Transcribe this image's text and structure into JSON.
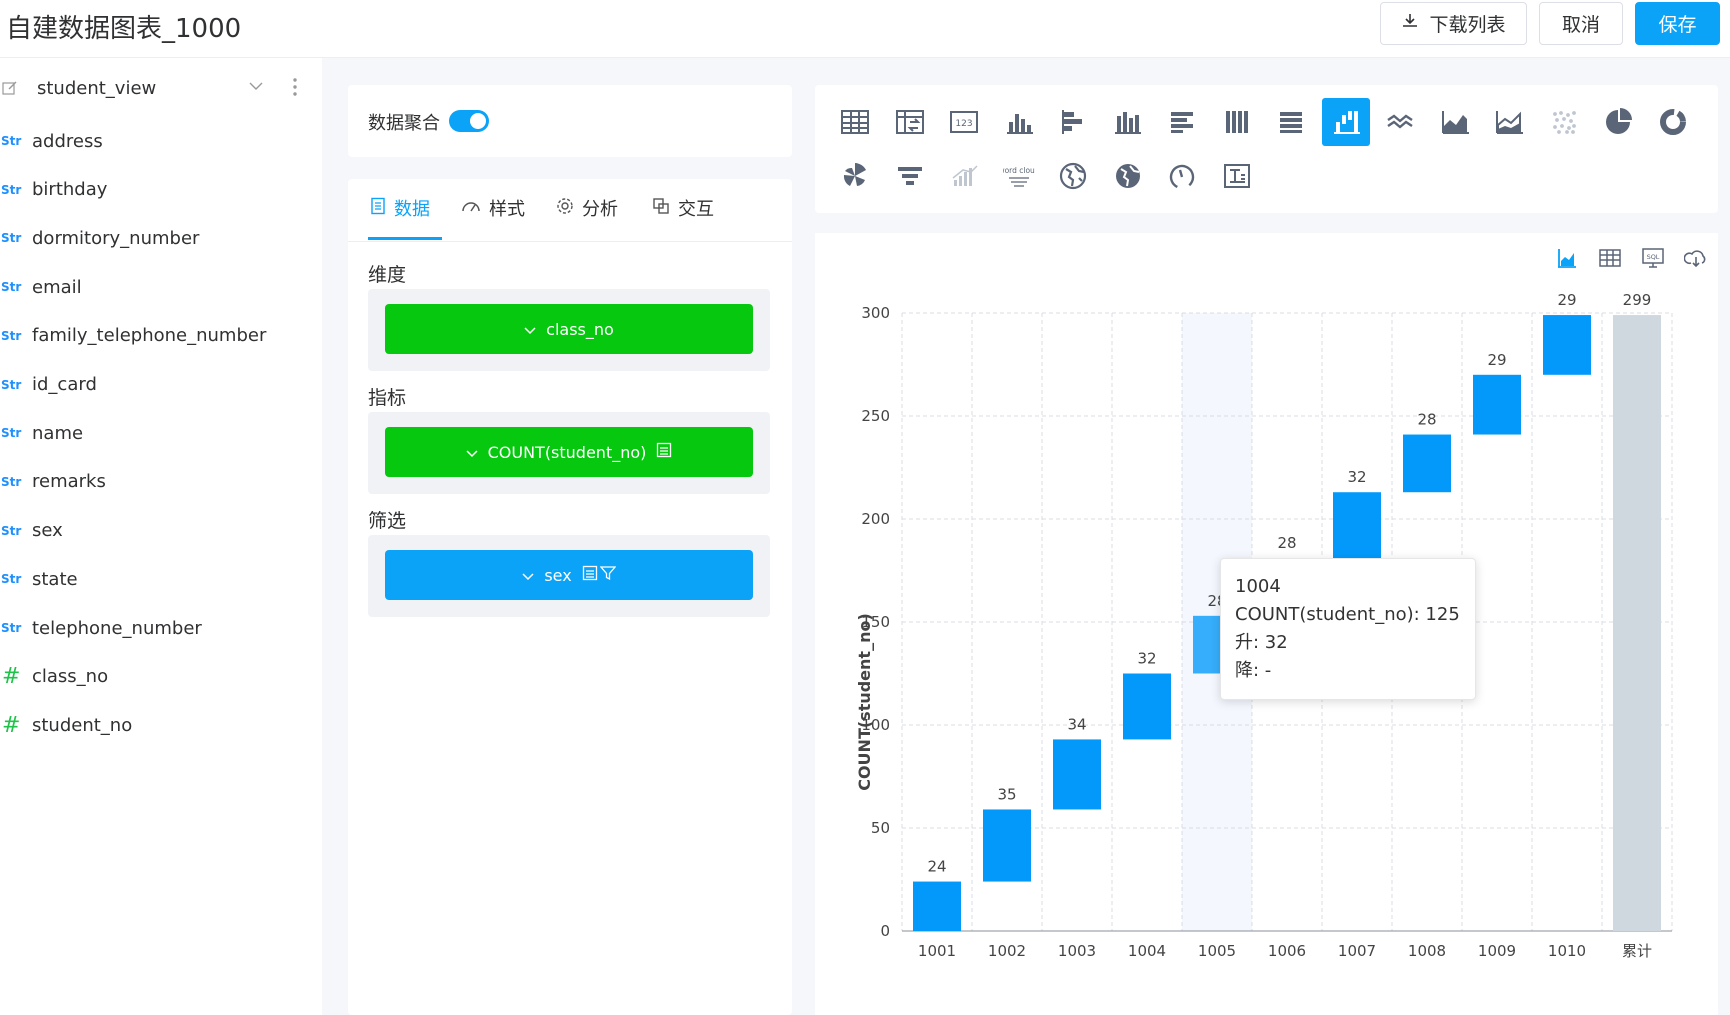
{
  "header": {
    "title": "自建数据图表_1000",
    "download_label": "下载列表",
    "cancel_label": "取消",
    "save_label": "保存"
  },
  "sidebar": {
    "view_name": "student_view",
    "fields": [
      {
        "type": "Str",
        "name": "address"
      },
      {
        "type": "Str",
        "name": "birthday"
      },
      {
        "type": "Str",
        "name": "dormitory_number"
      },
      {
        "type": "Str",
        "name": "email"
      },
      {
        "type": "Str",
        "name": "family_telephone_number"
      },
      {
        "type": "Str",
        "name": "id_card"
      },
      {
        "type": "Str",
        "name": "name"
      },
      {
        "type": "Str",
        "name": "remarks"
      },
      {
        "type": "Str",
        "name": "sex"
      },
      {
        "type": "Str",
        "name": "state"
      },
      {
        "type": "Str",
        "name": "telephone_number"
      },
      {
        "type": "#",
        "name": "class_no"
      },
      {
        "type": "#",
        "name": "student_no"
      }
    ]
  },
  "config": {
    "aggregate_label": "数据聚合",
    "aggregate_on": true,
    "tabs": [
      {
        "label": "数据",
        "icon": "data-icon",
        "active": true
      },
      {
        "label": "样式",
        "icon": "style-icon",
        "active": false
      },
      {
        "label": "分析",
        "icon": "analysis-icon",
        "active": false
      },
      {
        "label": "交互",
        "icon": "interaction-icon",
        "active": false
      }
    ],
    "dimension_label": "维度",
    "dimension_value": "class_no",
    "metric_label": "指标",
    "metric_value": "COUNT(student_no)",
    "filter_label": "筛选",
    "filter_value": "sex"
  },
  "chart_types": {
    "selected": "waterfall",
    "icons": [
      "table-icon",
      "pivot-table-icon",
      "number-card-icon",
      "bar-chart-icon",
      "horizontal-bar-icon",
      "grouped-column-icon",
      "stacked-horizontal-bar-icon",
      "percent-column-icon",
      "percent-horizontal-bar-icon",
      "waterfall-icon",
      "line-chart-icon",
      "area-chart-icon",
      "stacked-area-icon",
      "scatter-icon",
      "pie-chart-icon",
      "donut-chart-icon",
      "rose-chart-icon",
      "funnel-chart-icon",
      "progress-bar-icon",
      "word-cloud-icon",
      "map-icon",
      "bubble-map-icon",
      "gauge-icon",
      "text-card-icon"
    ],
    "word_cloud_text": "word cloud"
  },
  "chart_toolbar": [
    "chart-view-icon",
    "table-view-icon",
    "sql-view-icon",
    "export-cloud-icon"
  ],
  "chart_data": {
    "type": "bar",
    "subtype": "waterfall",
    "categories": [
      "1001",
      "1002",
      "1003",
      "1004",
      "1005",
      "1006",
      "1007",
      "1008",
      "1009",
      "1010",
      "累计"
    ],
    "values": [
      24,
      35,
      34,
      32,
      28,
      28,
      32,
      28,
      29,
      29,
      299
    ],
    "ylabel": "COUNT(student_no)",
    "ylim": [
      0,
      300
    ],
    "yticks": [
      0,
      50,
      100,
      150,
      200,
      250,
      300
    ],
    "colors": {
      "bar": "#0399fb",
      "total": "#cfd7df",
      "highlight_bar": "#36aefb",
      "hover_band": "#f4f8fe"
    },
    "grid": true,
    "hover_category": "1005"
  },
  "tooltip": {
    "title": "1004",
    "line1": "COUNT(student_no): 125",
    "line2": "升: 32",
    "line3": "降: -"
  }
}
